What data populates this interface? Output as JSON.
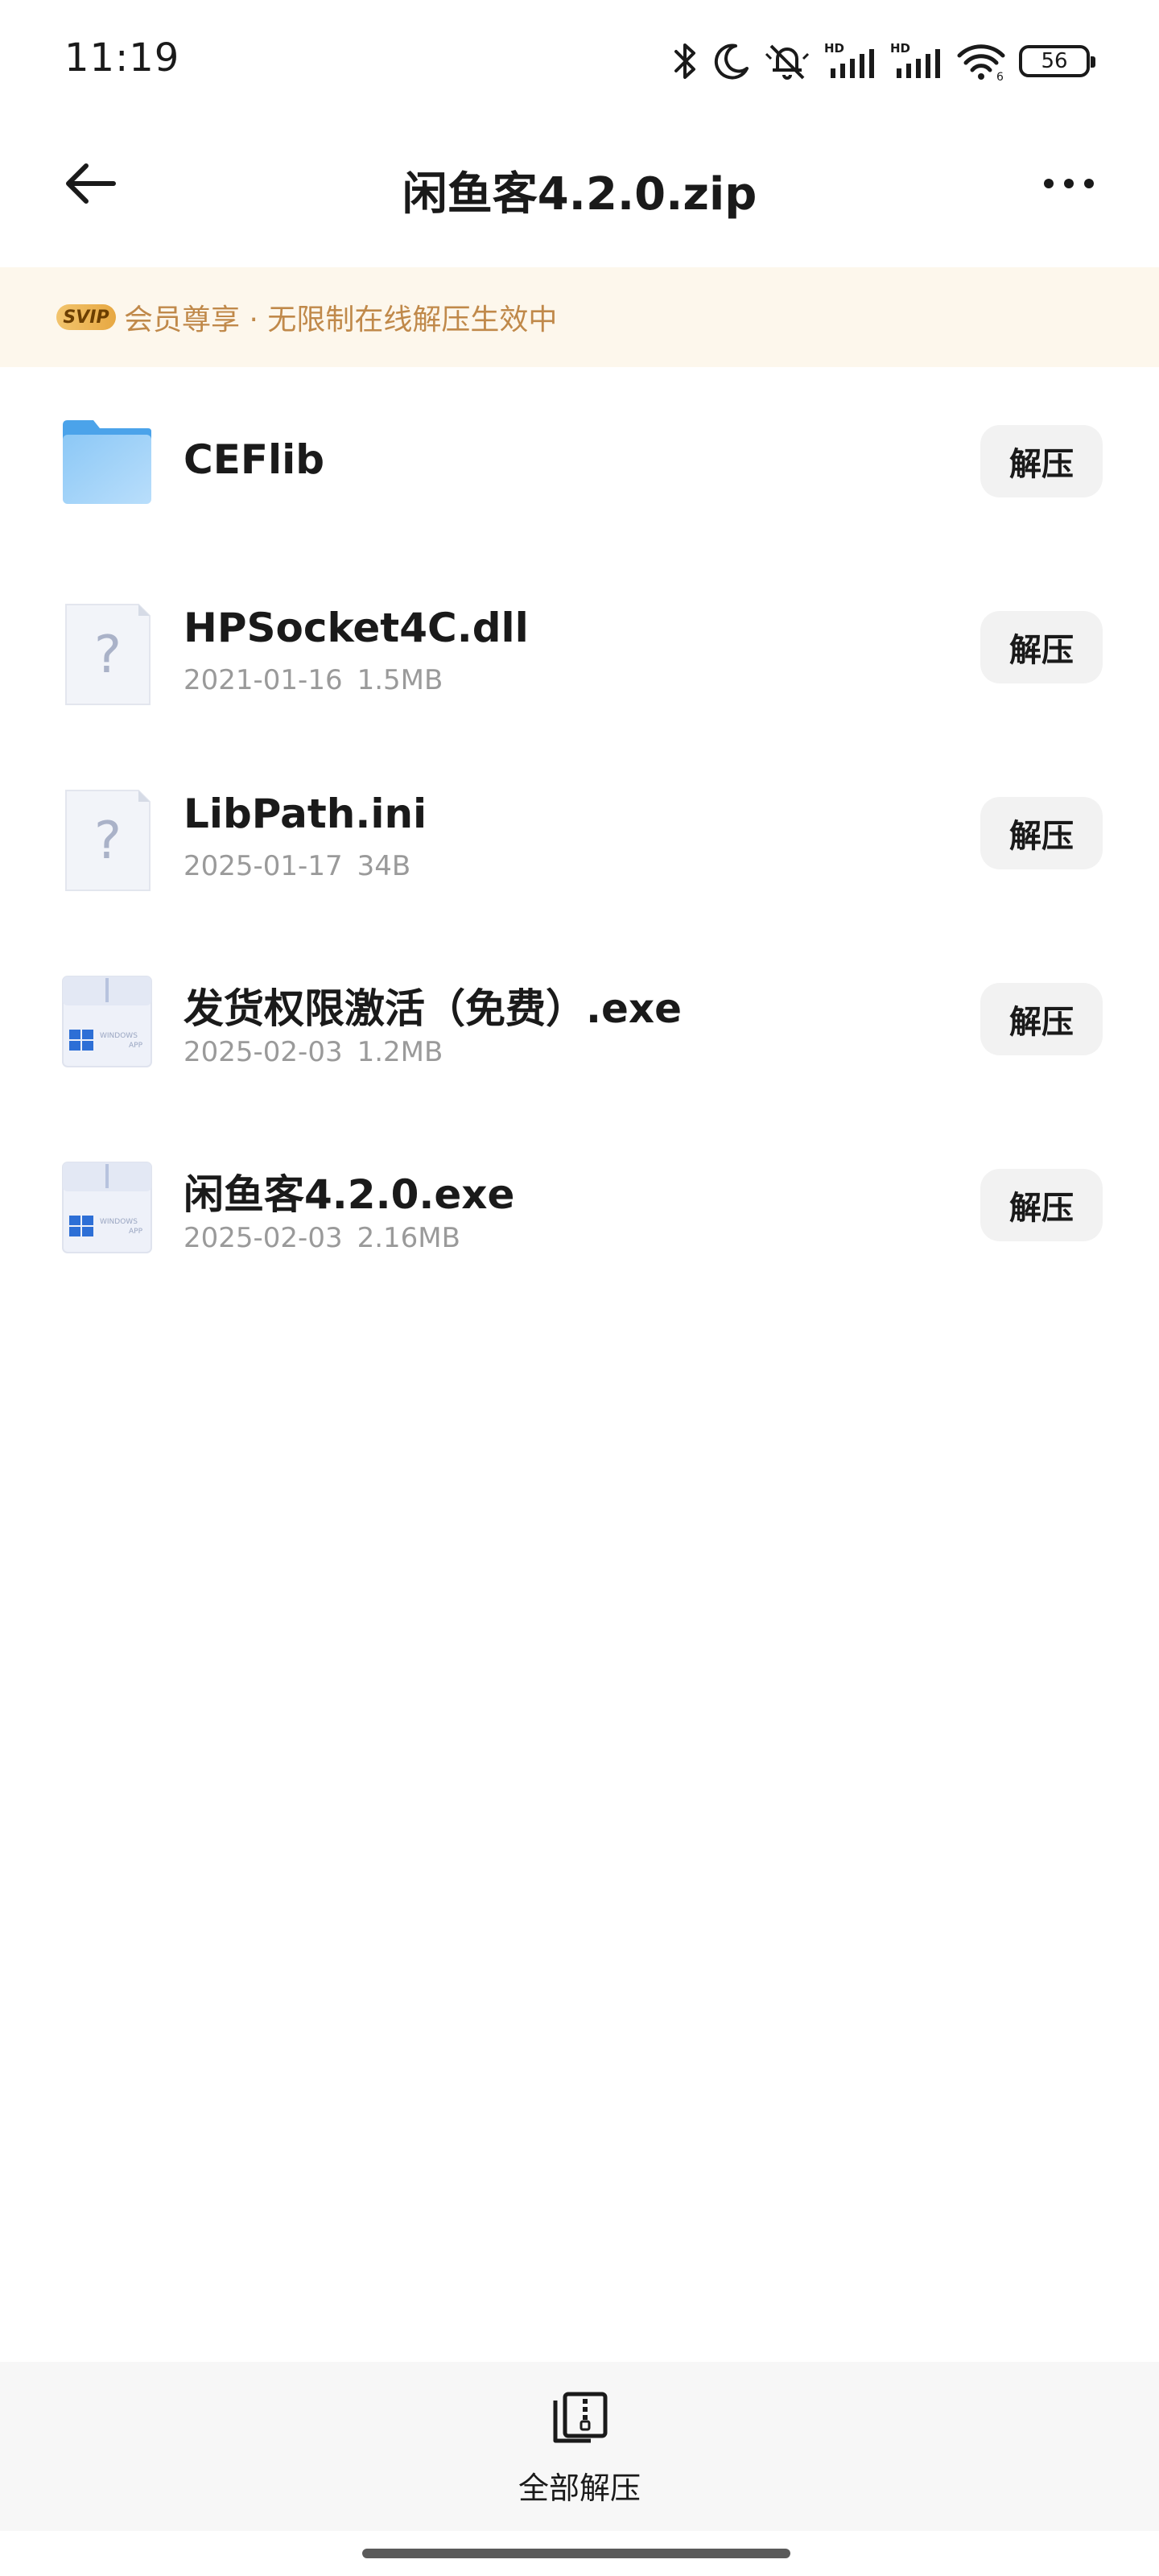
{
  "status_bar": {
    "time": "11:19",
    "battery": "56",
    "icons": [
      "bluetooth-icon",
      "moon-icon",
      "bell-muted-icon",
      "hd-signal-icon",
      "hd-signal-icon",
      "wifi-icon",
      "battery-icon"
    ],
    "wifi_sub": "6"
  },
  "header": {
    "title": "闲鱼客4.2.0.zip",
    "back_icon": "arrow-left-icon",
    "more_icon": "more-horizontal-icon"
  },
  "vip_banner": {
    "badge": "SVIP",
    "text": "会员尊享 · 无限制在线解压生效中",
    "color": "#c0894a",
    "background": "#fdf7ec"
  },
  "files": [
    {
      "name": "CEFlib",
      "type": "folder",
      "date": "",
      "size": "",
      "action": "解压"
    },
    {
      "name": "HPSocket4C.dll",
      "type": "unknown",
      "date": "2021-01-16",
      "size": "1.5MB",
      "action": "解压"
    },
    {
      "name": "LibPath.ini",
      "type": "unknown",
      "date": "2025-01-17",
      "size": "34B",
      "action": "解压"
    },
    {
      "name": "发货权限激活（免费）.exe",
      "type": "windows-app",
      "date": "2025-02-03",
      "size": "1.2MB",
      "action": "解压"
    },
    {
      "name": "闲鱼客4.2.0.exe",
      "type": "windows-app",
      "date": "2025-02-03",
      "size": "2.16MB",
      "action": "解压"
    }
  ],
  "bottom_bar": {
    "label": "全部解压",
    "icon": "extract-all-icon"
  }
}
